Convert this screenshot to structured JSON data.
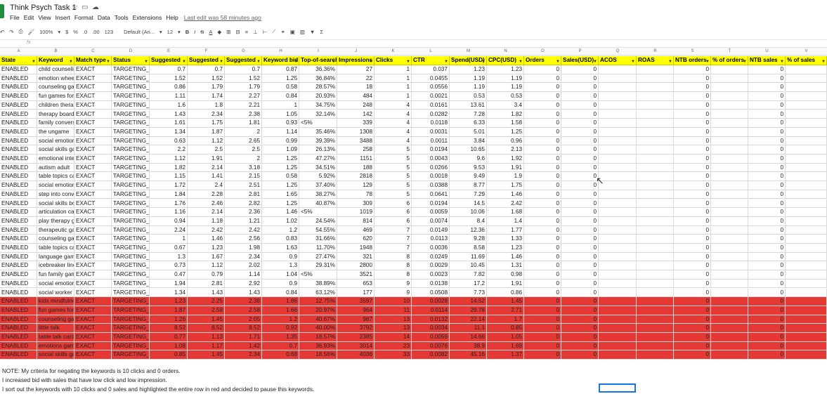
{
  "app": {
    "doc_title": "Think Psych Task 1",
    "menu": [
      "File",
      "Edit",
      "View",
      "Insert",
      "Format",
      "Data",
      "Tools",
      "Extensions",
      "Help"
    ],
    "last_edit": "Last edit was 58 minutes ago"
  },
  "toolbar": {
    "zoom": "100%",
    "currency": "$",
    "percent": "%",
    "dec_less": ".0",
    "dec_more": ".00",
    "format_more": "123",
    "font": "Default (Ari...",
    "font_size": "12",
    "bold": "B",
    "italic": "I",
    "strike": "S",
    "text_color": "A"
  },
  "formula_bar": {
    "fx": "fx",
    "value": ""
  },
  "column_letters": [
    "A",
    "B",
    "C",
    "D",
    "E",
    "F",
    "G",
    "H",
    "I",
    "J",
    "K",
    "L",
    "M",
    "N",
    "O",
    "P",
    "Q",
    "R",
    "S",
    "T",
    "U",
    "V"
  ],
  "headers": [
    "State",
    "Keyword",
    "Match type",
    "Status",
    "Suggested",
    "Suggested",
    "Suggested",
    "Keyword bid",
    "Top-of-search",
    "Impressions",
    "Clicks",
    "CTR",
    "Spend(USD)",
    "CPC(USD)",
    "Orders",
    "Sales(USD)",
    "ACOS",
    "ROAS",
    "NTB orders",
    "% of orders",
    "NTB sales",
    "% of sales"
  ],
  "rows": [
    [
      "ENABLED",
      "child counseling",
      "EXACT",
      "TARGETING_",
      "0.7",
      "0.7",
      "0.7",
      "0.87",
      "36.36%",
      "27",
      "1",
      "0.037",
      "1.23",
      "1.23",
      "0",
      "0",
      "",
      "",
      "0",
      "",
      "0",
      ""
    ],
    [
      "ENABLED",
      "emotion wheel",
      "EXACT",
      "TARGETING_",
      "1.52",
      "1.52",
      "1.52",
      "1.25",
      "36.84%",
      "22",
      "1",
      "0.0455",
      "1.19",
      "1.19",
      "0",
      "0",
      "",
      "",
      "0",
      "",
      "0",
      ""
    ],
    [
      "ENABLED",
      "counseling games",
      "EXACT",
      "TARGETING_",
      "0.86",
      "1.79",
      "1.79",
      "0.58",
      "28.57%",
      "18",
      "1",
      "0.0556",
      "1.19",
      "1.19",
      "0",
      "0",
      "",
      "",
      "0",
      "",
      "0",
      ""
    ],
    [
      "ENABLED",
      "fun games for kids",
      "EXACT",
      "TARGETING_",
      "1.11",
      "1.74",
      "2.27",
      "0.84",
      "20.93%",
      "484",
      "1",
      "0.0021",
      "0.53",
      "0.53",
      "0",
      "0",
      "",
      "",
      "0",
      "",
      "0",
      ""
    ],
    [
      "ENABLED",
      "children therapy",
      "EXACT",
      "TARGETING_",
      "1.6",
      "1.8",
      "2.21",
      "1",
      "34.75%",
      "248",
      "4",
      "0.0161",
      "13.61",
      "3.4",
      "0",
      "0",
      "",
      "",
      "0",
      "",
      "0",
      ""
    ],
    [
      "ENABLED",
      "therapy board",
      "EXACT",
      "TARGETING_",
      "1.43",
      "2.34",
      "2.38",
      "1.05",
      "32.14%",
      "142",
      "4",
      "0.0282",
      "7.28",
      "1.82",
      "0",
      "0",
      "",
      "",
      "0",
      "",
      "0",
      ""
    ],
    [
      "ENABLED",
      "family conversation",
      "EXACT",
      "TARGETING_",
      "1.61",
      "1.75",
      "1.81",
      "0.93",
      "<5%",
      "339",
      "4",
      "0.0118",
      "6.33",
      "1.58",
      "0",
      "0",
      "",
      "",
      "0",
      "",
      "0",
      ""
    ],
    [
      "ENABLED",
      "the ungame",
      "EXACT",
      "TARGETING_",
      "1.34",
      "1.87",
      "2",
      "1.14",
      "35.46%",
      "1308",
      "4",
      "0.0031",
      "5.01",
      "1.25",
      "0",
      "0",
      "",
      "",
      "0",
      "",
      "0",
      ""
    ],
    [
      "ENABLED",
      "social emotional",
      "EXACT",
      "TARGETING_",
      "0.63",
      "1.12",
      "2.65",
      "0.99",
      "39.39%",
      "3488",
      "4",
      "0.0011",
      "3.84",
      "0.96",
      "0",
      "0",
      "",
      "",
      "0",
      "",
      "0",
      ""
    ],
    [
      "ENABLED",
      "social skills games",
      "EXACT",
      "TARGETING_",
      "2.2",
      "2.5",
      "2.5",
      "1.09",
      "26.13%",
      "258",
      "5",
      "0.0194",
      "10.65",
      "2.13",
      "0",
      "0",
      "",
      "",
      "0",
      "",
      "0",
      ""
    ],
    [
      "ENABLED",
      "emotional intelligence",
      "EXACT",
      "TARGETING_",
      "1.12",
      "1.91",
      "2",
      "1.25",
      "47.27%",
      "1151",
      "5",
      "0.0043",
      "9.6",
      "1.92",
      "0",
      "0",
      "",
      "",
      "0",
      "",
      "0",
      ""
    ],
    [
      "ENABLED",
      "autism adult",
      "EXACT",
      "TARGETING_",
      "1.82",
      "2.14",
      "3.18",
      "1.25",
      "34.51%",
      "188",
      "5",
      "0.0266",
      "9.53",
      "1.91",
      "0",
      "0",
      "",
      "",
      "0",
      "",
      "0",
      ""
    ],
    [
      "ENABLED",
      "table topics cards",
      "EXACT",
      "TARGETING_",
      "1.15",
      "1.41",
      "2.15",
      "0.58",
      "5.92%",
      "2818",
      "5",
      "0.0018",
      "9.49",
      "1.9",
      "0",
      "0",
      "",
      "",
      "0",
      "",
      "0",
      ""
    ],
    [
      "ENABLED",
      "social emotional",
      "EXACT",
      "TARGETING_",
      "1.72",
      "2.4",
      "2.51",
      "1.25",
      "37.40%",
      "129",
      "5",
      "0.0388",
      "8.77",
      "1.75",
      "0",
      "0",
      "",
      "",
      "0",
      "",
      "0",
      ""
    ],
    [
      "ENABLED",
      "step into conversation",
      "EXACT",
      "TARGETING_",
      "1.84",
      "2.28",
      "2.81",
      "1.65",
      "38.27%",
      "78",
      "5",
      "0.0641",
      "7.29",
      "1.46",
      "0",
      "0",
      "",
      "",
      "0",
      "",
      "0",
      ""
    ],
    [
      "ENABLED",
      "social skills board",
      "EXACT",
      "TARGETING_",
      "1.76",
      "2.46",
      "2.82",
      "1.25",
      "40.87%",
      "309",
      "6",
      "0.0194",
      "14.5",
      "2.42",
      "0",
      "0",
      "",
      "",
      "0",
      "",
      "0",
      ""
    ],
    [
      "ENABLED",
      "articulation cards",
      "EXACT",
      "TARGETING_",
      "1.16",
      "2.14",
      "2.36",
      "1.46",
      "<5%",
      "1019",
      "6",
      "0.0059",
      "10.06",
      "1.68",
      "0",
      "0",
      "",
      "",
      "0",
      "",
      "0",
      ""
    ],
    [
      "ENABLED",
      "play therapy games",
      "EXACT",
      "TARGETING_",
      "0.94",
      "1.18",
      "1.21",
      "1.02",
      "24.54%",
      "814",
      "6",
      "0.0074",
      "8.4",
      "1.4",
      "0",
      "0",
      "",
      "",
      "0",
      "",
      "0",
      ""
    ],
    [
      "ENABLED",
      "therapeutic games",
      "EXACT",
      "TARGETING_",
      "2.24",
      "2.42",
      "2.42",
      "1.2",
      "54.55%",
      "469",
      "7",
      "0.0149",
      "12.36",
      "1.77",
      "0",
      "0",
      "",
      "",
      "0",
      "",
      "0",
      ""
    ],
    [
      "ENABLED",
      "counseling games",
      "EXACT",
      "TARGETING_",
      "1",
      "1.46",
      "2.56",
      "0.83",
      "31.66%",
      "620",
      "7",
      "0.0113",
      "9.28",
      "1.33",
      "0",
      "0",
      "",
      "",
      "0",
      "",
      "0",
      ""
    ],
    [
      "ENABLED",
      "table topics cards",
      "EXACT",
      "TARGETING_",
      "0.67",
      "1.23",
      "1.98",
      "1.63",
      "11.70%",
      "1948",
      "7",
      "0.0036",
      "8.58",
      "1.23",
      "0",
      "0",
      "",
      "",
      "0",
      "",
      "0",
      ""
    ],
    [
      "ENABLED",
      "language games",
      "EXACT",
      "TARGETING_",
      "1.3",
      "1.67",
      "2.34",
      "0.9",
      "27.47%",
      "321",
      "8",
      "0.0249",
      "11.69",
      "1.46",
      "0",
      "0",
      "",
      "",
      "0",
      "",
      "0",
      ""
    ],
    [
      "ENABLED",
      "icebreaker line",
      "EXACT",
      "TARGETING_",
      "0.73",
      "1.12",
      "2.02",
      "1.3",
      "29.31%",
      "2800",
      "8",
      "0.0029",
      "10.45",
      "1.31",
      "0",
      "0",
      "",
      "",
      "0",
      "",
      "0",
      ""
    ],
    [
      "ENABLED",
      "fun family games",
      "EXACT",
      "TARGETING_",
      "0.47",
      "0.79",
      "1.14",
      "1.04",
      "<5%",
      "3521",
      "8",
      "0.0023",
      "7.82",
      "0.98",
      "0",
      "0",
      "",
      "",
      "0",
      "",
      "0",
      ""
    ],
    [
      "ENABLED",
      "social emotional",
      "EXACT",
      "TARGETING_",
      "1.94",
      "2.81",
      "2.92",
      "0.9",
      "38.89%",
      "653",
      "9",
      "0.0138",
      "17.2",
      "1.91",
      "0",
      "0",
      "",
      "",
      "0",
      "",
      "0",
      ""
    ],
    [
      "ENABLED",
      "social worker",
      "EXACT",
      "TARGETING_",
      "1.34",
      "1.43",
      "1.43",
      "0.84",
      "63.12%",
      "177",
      "9",
      "0.0508",
      "7.73",
      "0.86",
      "0",
      "0",
      "",
      "",
      "0",
      "",
      "0",
      ""
    ],
    [
      "ENABLED",
      "kids mindfulness",
      "EXACT",
      "TARGETING_",
      "1.23",
      "2.25",
      "2.38",
      "1.86",
      "12.75%",
      "3597",
      "10",
      "0.0028",
      "14.52",
      "1.45",
      "0",
      "0",
      "",
      "",
      "0",
      "",
      "0",
      ""
    ],
    [
      "ENABLED",
      "fun games for kids",
      "EXACT",
      "TARGETING_",
      "1.87",
      "2.58",
      "2.58",
      "1.66",
      "20.97%",
      "964",
      "11",
      "0.0114",
      "29.78",
      "2.71",
      "0",
      "0",
      "",
      "",
      "0",
      "",
      "0",
      ""
    ],
    [
      "ENABLED",
      "counseling games",
      "EXACT",
      "TARGETING_",
      "1.26",
      "1.45",
      "2.05",
      "1.2",
      "40.67%",
      "987",
      "13",
      "0.0132",
      "22.14",
      "1.7",
      "0",
      "0",
      "",
      "",
      "0",
      "",
      "0",
      ""
    ],
    [
      "ENABLED",
      "little talk",
      "EXACT",
      "TARGETING_",
      "8.52",
      "8.52",
      "8.52",
      "0.92",
      "40.00%",
      "3792",
      "13",
      "0.0034",
      "11.1",
      "0.85",
      "0",
      "0",
      "",
      "",
      "0",
      "",
      "0",
      ""
    ],
    [
      "ENABLED",
      "table talk cards",
      "EXACT",
      "TARGETING_",
      "0.77",
      "1.13",
      "1.71",
      "1.35",
      "18.57%",
      "2385",
      "14",
      "0.0059",
      "14.66",
      "1.05",
      "0",
      "0",
      "",
      "",
      "0",
      "",
      "0",
      ""
    ],
    [
      "ENABLED",
      "emotions games",
      "EXACT",
      "TARGETING_",
      "1.08",
      "1.17",
      "1.42",
      "0.7",
      "36.93%",
      "3014",
      "23",
      "0.0076",
      "38.9",
      "1.69",
      "0",
      "0",
      "",
      "",
      "0",
      "",
      "0",
      ""
    ],
    [
      "ENABLED",
      "social skills games",
      "EXACT",
      "TARGETING_",
      "0.85",
      "1.45",
      "2.34",
      "0.68",
      "18.56%",
      "4036",
      "33",
      "0.0082",
      "45.16",
      "1.37",
      "0",
      "0",
      "",
      "",
      "0",
      "",
      "0",
      ""
    ]
  ],
  "red_rows_from": 26,
  "notes": [
    "NOTE: My criteria for negating the keywords is 10 clicks and 0 orders.",
    "I increased bid with sales that have low click and low impression.",
    "I sort out the keywords with 10 clicks and 0 sales and highlighted the entire row in red and decided to pause this keywords."
  ],
  "colors": {
    "header_bg": "#ffff00",
    "negate_bg": "#e53935",
    "logo": "#1e8e3e"
  }
}
